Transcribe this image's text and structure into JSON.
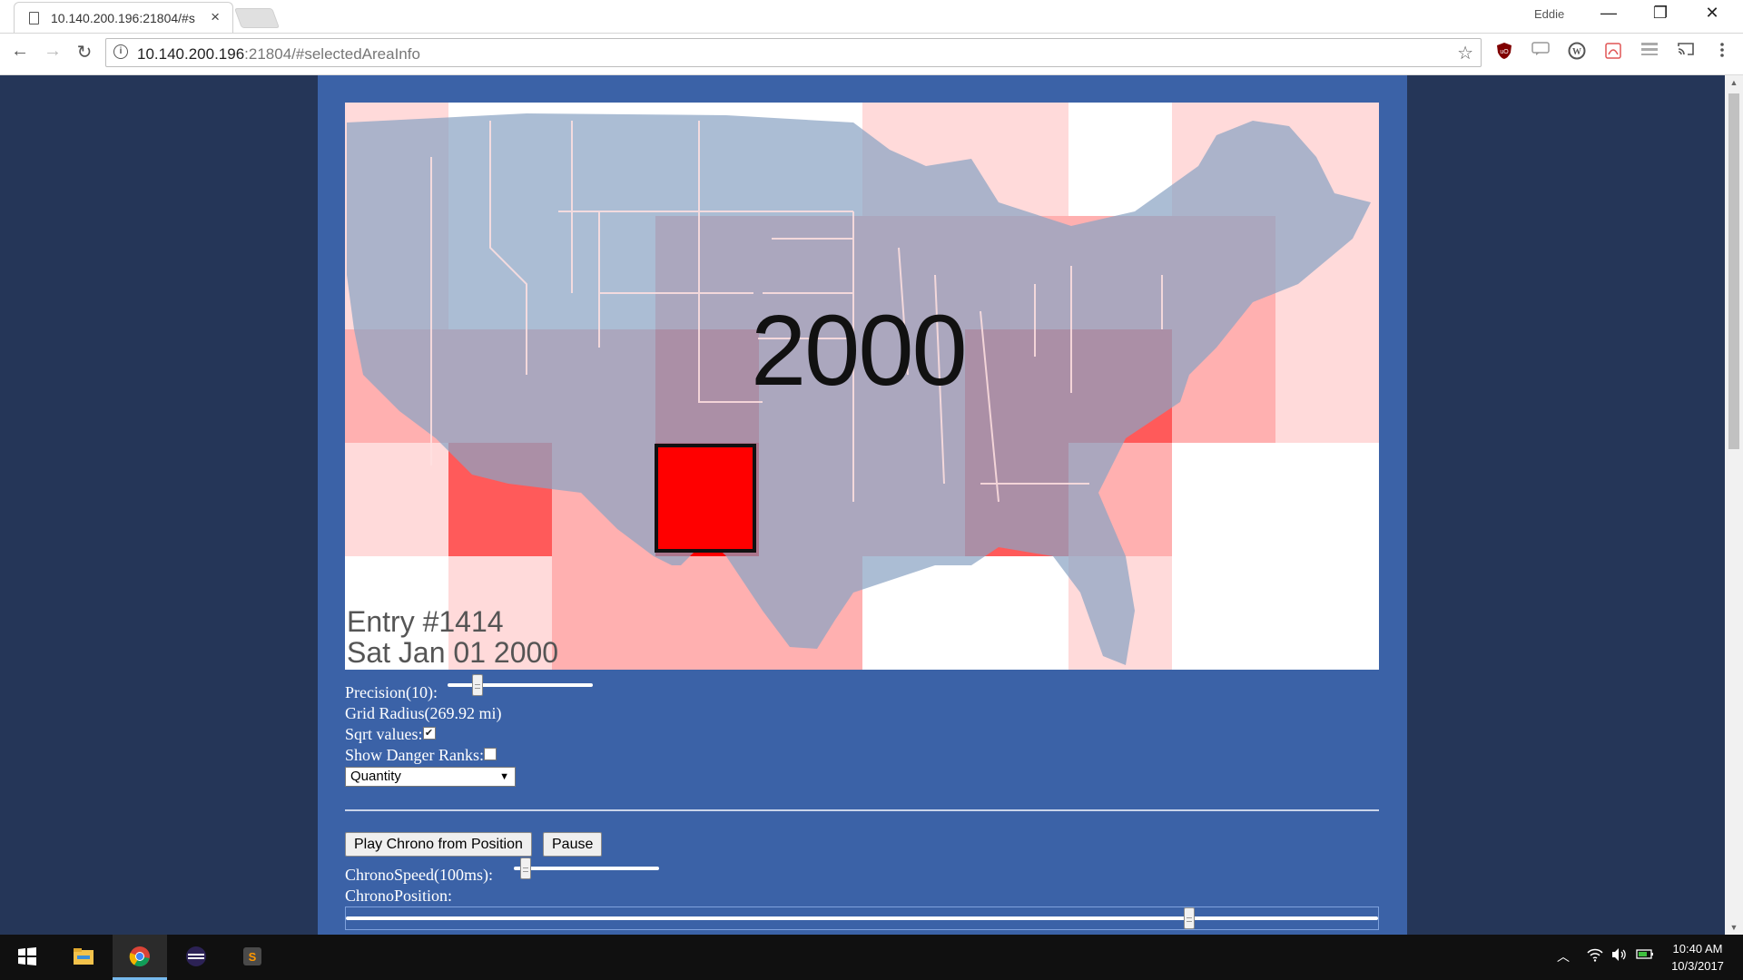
{
  "browser": {
    "tab_title": "10.140.200.196:21804/#s",
    "tab_close": "×",
    "profile_name": "Eddie",
    "url_host": "10.140.200.196",
    "url_rest": ":21804/#selectedAreaInfo",
    "window_controls": {
      "minimize": "—",
      "restore": "❐",
      "close": "✕"
    },
    "nav": {
      "back": "←",
      "forward": "→",
      "reload": "↻"
    },
    "extension_icons": [
      "ublock-icon",
      "speech-icon",
      "wordpress-icon",
      "pdf-icon",
      "reader-icon",
      "cast-icon",
      "menu-icon"
    ]
  },
  "map": {
    "year_label": "2000",
    "entry_line1": "Entry #1414",
    "entry_line2": "Sat Jan 01 2000",
    "heat_colors": {
      "none": "#ffffff",
      "low": "#ffdada",
      "mid": "#ffb0b0",
      "high": "#ff5a5a",
      "max": "#ff0000"
    },
    "land_color": "#8ba3c4"
  },
  "controls": {
    "precision_label": "Precision(10):",
    "precision_value": 0.18,
    "grid_radius_label": "Grid Radius(269.92 mi)",
    "sqrt_label": "Sqrt values:",
    "sqrt_checked": true,
    "danger_label": "Show Danger Ranks:",
    "danger_checked": false,
    "metric_selected": "Quantity",
    "play_button": "Play Chrono from Position",
    "pause_button": "Pause",
    "chrono_speed_label": "ChronoSpeed(100ms):",
    "chrono_speed_value": 0.05,
    "chrono_position_label": "ChronoPosition:",
    "chrono_position_value": 0.82
  },
  "taskbar": {
    "time": "10:40 AM",
    "date": "10/3/2017",
    "apps": [
      "windows-start-icon",
      "file-explorer-icon",
      "chrome-icon",
      "eclipse-icon",
      "sublime-text-icon"
    ]
  }
}
